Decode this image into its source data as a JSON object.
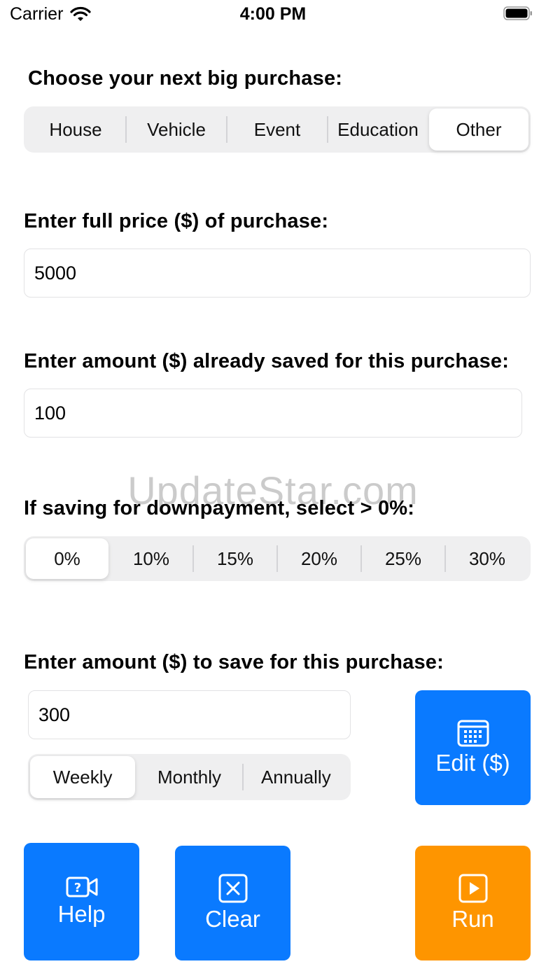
{
  "status": {
    "carrier": "Carrier",
    "time": "4:00 PM"
  },
  "purchase": {
    "label": "Choose your next big purchase:",
    "options": [
      "House",
      "Vehicle",
      "Event",
      "Education",
      "Other"
    ],
    "selected": "Other"
  },
  "price": {
    "label": "Enter full price ($) of purchase:",
    "value": "5000"
  },
  "saved": {
    "label": "Enter amount ($) already saved for this purchase:",
    "value": "100"
  },
  "downpayment": {
    "label": "If saving for downpayment, select > 0%:",
    "options": [
      "0%",
      "10%",
      "15%",
      "20%",
      "25%",
      "30%"
    ],
    "selected": "0%"
  },
  "save_amount": {
    "label": "Enter amount ($) to save for this purchase:",
    "value": "300",
    "frequency": [
      "Weekly",
      "Monthly",
      "Annually"
    ],
    "selected": "Weekly"
  },
  "buttons": {
    "edit": "Edit ($)",
    "help": "Help",
    "clear": "Clear",
    "run": "Run"
  },
  "watermark": "UpdateStar.com",
  "colors": {
    "blue": "#0a7aff",
    "orange": "#fe9500"
  }
}
